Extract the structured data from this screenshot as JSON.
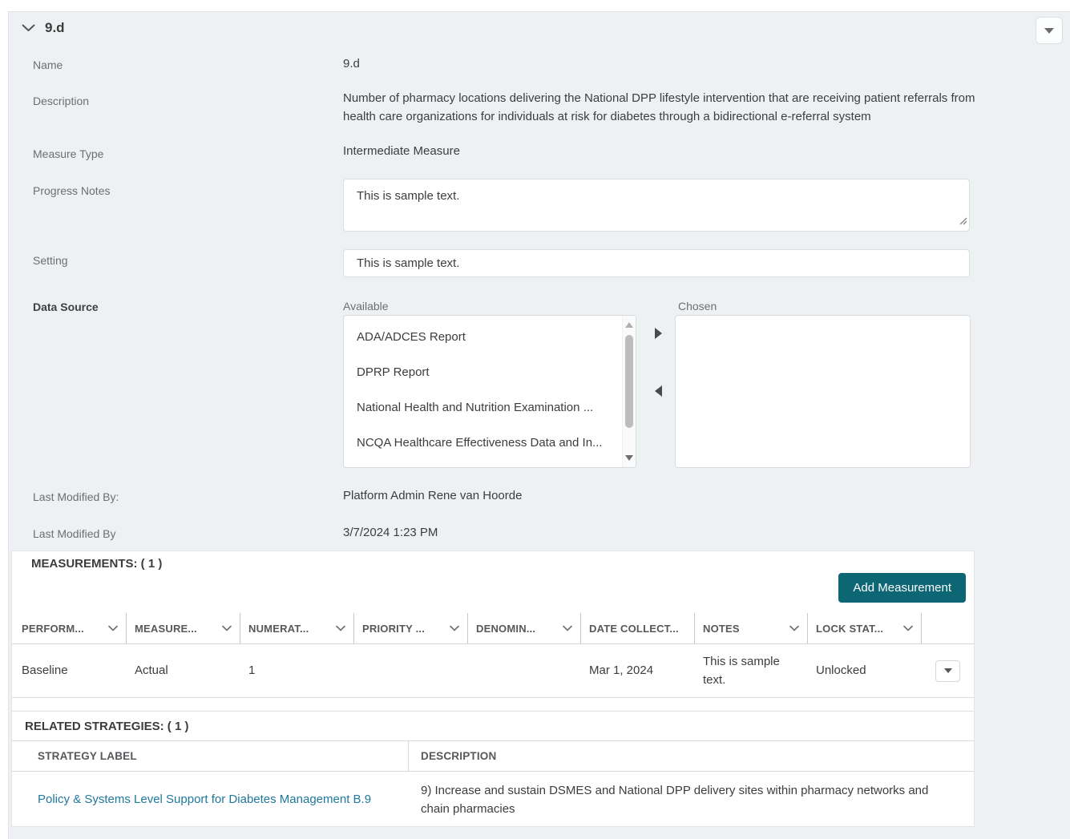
{
  "header": {
    "title": "9.d"
  },
  "fields": {
    "name": {
      "label": "Name",
      "value": "9.d"
    },
    "description": {
      "label": "Description",
      "value": "Number of pharmacy locations delivering the National DPP lifestyle intervention that are receiving patient referrals from health care organizations for individuals at risk for diabetes through a bidirectional e-referral system"
    },
    "measure_type": {
      "label": "Measure Type",
      "value": "Intermediate Measure"
    },
    "progress_notes": {
      "label": "Progress Notes",
      "value": "This is sample text."
    },
    "setting": {
      "label": "Setting",
      "value": "This is sample text."
    },
    "data_source": {
      "label": "Data Source",
      "available_label": "Available",
      "chosen_label": "Chosen",
      "available_options": [
        "ADA/ADCES Report",
        "DPRP Report",
        "National Health and Nutrition Examination ...",
        "NCQA Healthcare Effectiveness Data and In..."
      ],
      "chosen_options": []
    },
    "last_modified_by": {
      "label": "Last Modified By:",
      "value": "Platform Admin Rene van Hoorde"
    },
    "last_modified_date": {
      "label": "Last Modified By",
      "value": "3/7/2024 1:23 PM"
    }
  },
  "measurements": {
    "heading": "MEASUREMENTS: ( 1 )",
    "add_button_label": "Add Measurement",
    "columns": [
      "PERFORM...",
      "MEASURE...",
      "NUMERAT...",
      "PRIORITY ...",
      "DENOMIN...",
      "DATE COLLECT...",
      "NOTES",
      "LOCK STAT..."
    ],
    "rows": [
      {
        "performance": "Baseline",
        "measure": "Actual",
        "numerator": "1",
        "priority": "",
        "denominator": "",
        "date_collected": "Mar 1, 2024",
        "notes": "This is sample text.",
        "lock_status": "Unlocked"
      }
    ]
  },
  "related_strategies": {
    "heading": "RELATED STRATEGIES: ( 1 )",
    "columns": [
      "STRATEGY LABEL",
      "DESCRIPTION"
    ],
    "rows": [
      {
        "strategy_label": "Policy & Systems Level Support for Diabetes Management B.9",
        "description": "9) Increase and sustain DSMES and National DPP delivery sites within pharmacy networks and chain pharmacies"
      }
    ]
  },
  "colors": {
    "accent_teal": "#0d6674",
    "link": "#21789d",
    "panel_bg": "#eef1f4"
  }
}
